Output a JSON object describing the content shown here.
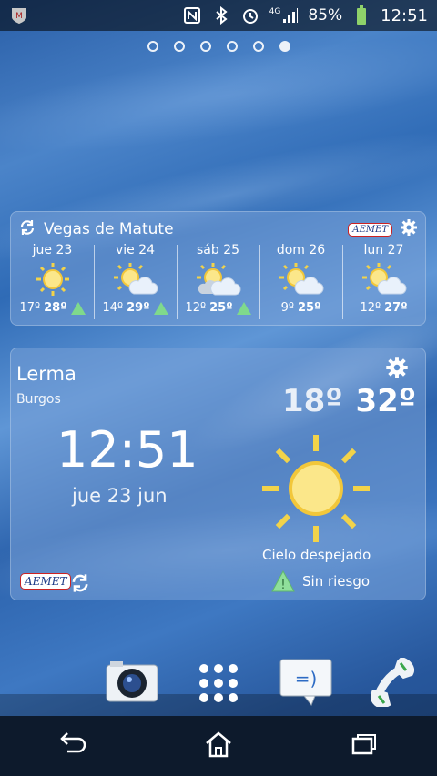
{
  "status_bar": {
    "network": "4G",
    "battery_percent": "85%",
    "time": "12:51",
    "icons": [
      "mcafee-icon",
      "nfc-icon",
      "bluetooth-icon",
      "alarm-icon",
      "signal-icon",
      "battery-icon"
    ]
  },
  "pager": {
    "count": 6,
    "active_index": 5
  },
  "forecast_widget": {
    "location": "Vegas de Matute",
    "logo_text": "AEMET",
    "days": [
      {
        "name": "jue 23",
        "min": "17º",
        "max": "28º",
        "icon": "sun-icon",
        "warning": true
      },
      {
        "name": "vie 24",
        "min": "14º",
        "max": "29º",
        "icon": "sun-cloud-icon",
        "warning": true
      },
      {
        "name": "sáb 25",
        "min": "12º",
        "max": "25º",
        "icon": "sun-clouds-icon",
        "warning": true
      },
      {
        "name": "dom 26",
        "min": "9º",
        "max": "25º",
        "icon": "sun-cloud-icon",
        "warning": false
      },
      {
        "name": "lun 27",
        "min": "12º",
        "max": "27º",
        "icon": "sun-cloud-icon",
        "warning": false
      }
    ]
  },
  "clock_widget": {
    "city": "Lerma",
    "province": "Burgos",
    "time": "12:51",
    "date": "jue 23 jun",
    "temp_min": "18º",
    "temp_max": "32º",
    "condition": "Cielo despejado",
    "risk": "Sin riesgo",
    "logo_text": "AEMET"
  },
  "dock": {
    "items": [
      "camera-app-icon",
      "apps-drawer-icon",
      "messaging-app-icon",
      "phone-app-icon"
    ]
  },
  "navbar": {
    "items": [
      "back-icon",
      "home-icon",
      "recent-apps-icon"
    ]
  }
}
